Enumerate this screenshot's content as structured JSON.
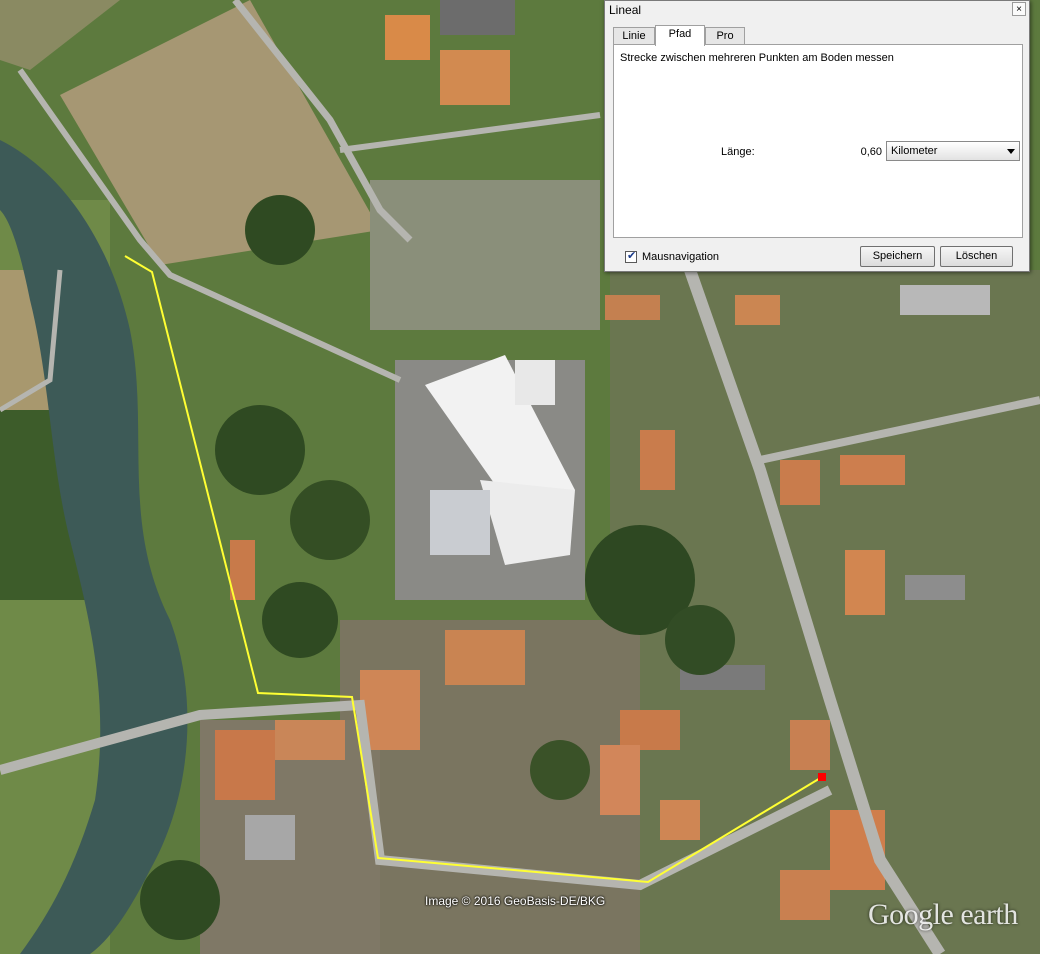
{
  "map": {
    "copyright": "Image © 2016 GeoBasis-DE/BKG",
    "logo": "Google earth",
    "path_color": "#ffff33",
    "end_marker_color": "#ff0000",
    "river_color": "#3d5a57",
    "field_color": "#a69773"
  },
  "dialog": {
    "title": "Lineal",
    "close_glyph": "×",
    "tabs": [
      {
        "label": "Linie",
        "active": false
      },
      {
        "label": "Pfad",
        "active": true
      },
      {
        "label": "Pro",
        "active": false
      }
    ],
    "description": "Strecke zwischen mehreren Punkten am Boden messen",
    "length_label": "Länge:",
    "length_value": "0,60",
    "unit_selected": "Kilometer",
    "mouse_nav_label": "Mausnavigation",
    "mouse_nav_checked": true,
    "save_label": "Speichern",
    "delete_label": "Löschen"
  }
}
